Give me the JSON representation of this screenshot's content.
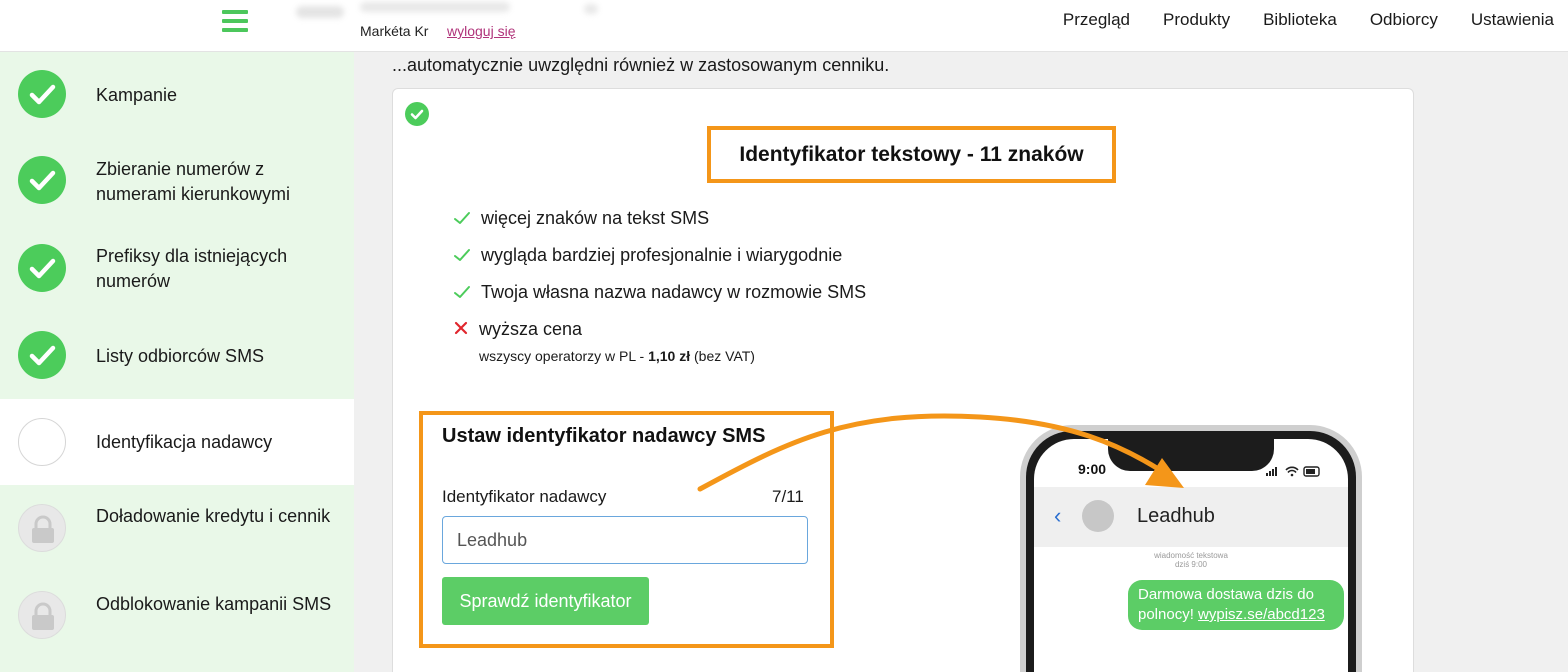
{
  "header": {
    "user_name": "Markéta Kr",
    "logout_label": "wyloguj się",
    "nav": [
      "Przegląd",
      "Produkty",
      "Biblioteka",
      "Odbiorcy",
      "Ustawienia"
    ]
  },
  "sidebar": {
    "steps": [
      {
        "label": "Kampanie",
        "state": "done"
      },
      {
        "label": "Zbieranie numerów z numerami kierunkowymi",
        "state": "done"
      },
      {
        "label": "Prefiksy dla istniejących numerów",
        "state": "done"
      },
      {
        "label": "Listy odbiorców SMS",
        "state": "done"
      },
      {
        "label": "Identyfikacja nadawcy",
        "state": "current"
      },
      {
        "label": "Doładowanie kredytu i cennik",
        "state": "locked"
      },
      {
        "label": "Odblokowanie kampanii SMS",
        "state": "locked"
      }
    ]
  },
  "main": {
    "intro": "...automatycznie uwzględni również w zastosowanym cenniku.",
    "card_title": "Identyfikator tekstowy - 11 znaków",
    "features": [
      {
        "text": "więcej znaków na tekst SMS",
        "type": "plus"
      },
      {
        "text": "wygląda bardziej profesjonalnie i wiarygodnie",
        "type": "plus"
      },
      {
        "text": "Twoja własna nazwa nadawcy w rozmowie SMS",
        "type": "plus"
      },
      {
        "text": "wyższa cena",
        "type": "minus"
      }
    ],
    "price_prefix": "wszyscy operatorzy w PL - ",
    "price_value": "1,10 zł",
    "price_suffix": " (bez VAT)"
  },
  "form": {
    "title": "Ustaw identyfikator nadawcy SMS",
    "field_label": "Identyfikator nadawcy",
    "counter": "7/11",
    "value": "Leadhub",
    "button_label": "Sprawdź identyfikator"
  },
  "phone": {
    "time": "9:00",
    "sender": "Leadhub",
    "meta_line1": "wiadomość tekstowa",
    "meta_line2": "dziś 9:00",
    "message_text": "Darmowa dostawa dzis do polnocy!",
    "message_link": "wypisz.se/abcd123"
  },
  "colors": {
    "accent_green": "#4ccc5b",
    "highlight_orange": "#f49619",
    "sidebar_done_bg": "#e9f8e8",
    "link_purple": "#b0337a"
  }
}
